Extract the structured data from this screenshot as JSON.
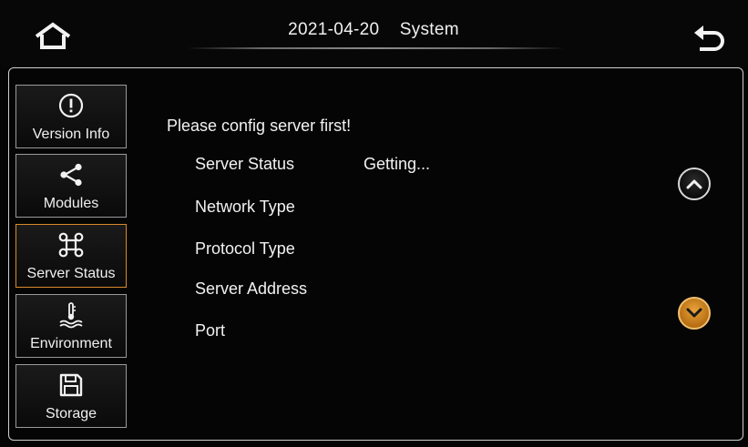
{
  "header": {
    "date": "2021-04-20",
    "title": "System",
    "home_icon": "home-icon",
    "back_icon": "back-arrow-icon"
  },
  "sidebar": {
    "items": [
      {
        "label": "Version Info",
        "icon": "info-icon",
        "active": false
      },
      {
        "label": "Modules",
        "icon": "share-icon",
        "active": false
      },
      {
        "label": "Server Status",
        "icon": "command-icon",
        "active": true
      },
      {
        "label": "Environment",
        "icon": "temperature-icon",
        "active": false
      },
      {
        "label": "Storage",
        "icon": "floppy-disk-icon",
        "active": false
      }
    ]
  },
  "main": {
    "notice": "Please config server first!",
    "fields": [
      {
        "label": "Server Status",
        "value": "Getting..."
      },
      {
        "label": "Network Type",
        "value": ""
      },
      {
        "label": "Protocol Type",
        "value": ""
      },
      {
        "label": "Server Address",
        "value": ""
      },
      {
        "label": "Port",
        "value": ""
      }
    ]
  },
  "scroll": {
    "up_icon": "chevron-up-icon",
    "down_icon": "chevron-down-icon"
  },
  "colors": {
    "accent": "#d98a2a",
    "background": "#050505",
    "text": "#f2f2f2"
  }
}
